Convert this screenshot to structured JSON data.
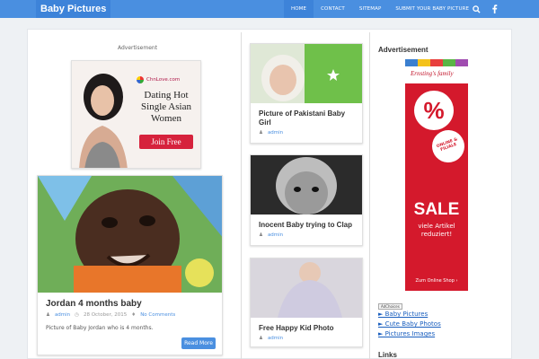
{
  "header": {
    "brand": "Baby Pictures",
    "nav": [
      "HOME",
      "CONTACT",
      "SITEMAP",
      "SUBMIT YOUR BABY PICTURE"
    ],
    "icons": [
      "search-icon",
      "facebook-icon"
    ]
  },
  "left_column": {
    "ad_label": "Advertisement",
    "ad": {
      "brand": "ChnLove.com",
      "headline": "Dating Hot Single Asian Women",
      "button": "Join Free"
    },
    "post": {
      "title": "Jordan 4 months baby",
      "author": "admin",
      "date": "28 October, 2015",
      "comments": "No Comments",
      "excerpt": "Picture of Baby Jordan who is 4 months.",
      "read_more": "Read More"
    }
  },
  "middle_column": {
    "posts": [
      {
        "title": "Picture of Pakistani Baby Girl",
        "author": "admin"
      },
      {
        "title": "Inocent Baby trying to Clap",
        "author": "admin"
      },
      {
        "title": "Free Happy Kid Photo",
        "author": "admin"
      }
    ]
  },
  "sidebar": {
    "ad_title": "Advertisement",
    "ad": {
      "brand": "Ernsting's family",
      "percent": "%",
      "badge": "ONLINE & FILIALE",
      "sale": "SALE",
      "sub": "viele Artikel reduziert!",
      "button": "Zum Online Shop ›"
    },
    "adchoices": "AdChoices",
    "links": [
      "► Baby Pictures",
      "► Cute Baby Photos",
      "► Pictures Images"
    ],
    "links_title": "Links"
  },
  "colors": {
    "header": "#4a8fe0",
    "accent": "#3d83d9",
    "sale_red": "#d4192c"
  }
}
